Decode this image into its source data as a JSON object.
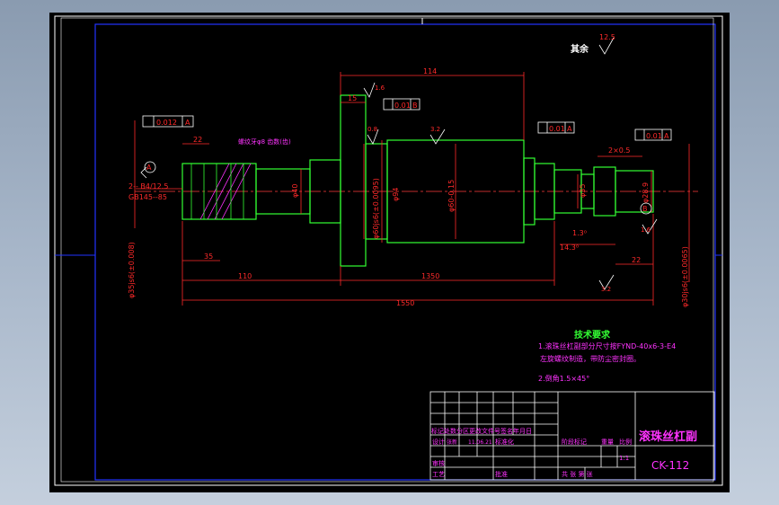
{
  "drawing": {
    "surface_note": "其余",
    "surface_roughness_general": "12.5",
    "dimensions": {
      "d114": "114",
      "d15": "15",
      "d22": "22",
      "d2x05": "2×0.5",
      "d35": "35",
      "d110": "110",
      "d1350": "1350",
      "d1550": "1550",
      "d22b": "22",
      "d143": "14.3⁰",
      "d13": "1.3⁰",
      "thread_spec": "2-- B4/12.5",
      "thread_std": "GB145--85"
    },
    "diameters": {
      "dia35": "φ35js6(±0.008)",
      "dia40": "φ40",
      "dia60js6": "φ60js6(±0.0095)",
      "dia94": "φ94",
      "dia60": "φ60-0.15",
      "dia35b": "φ35",
      "dia28": "φ28.9",
      "dia30": "φ30js6(±0.0065)"
    },
    "roughness": {
      "r16a": "1.6",
      "r08": "0.8",
      "r32": "3.2",
      "r16b": "1.6",
      "r32b": "3.2"
    },
    "tolerance_frames": {
      "runout_left": "0.012",
      "runout_left_ref": "A",
      "runout_top": "0.01",
      "runout_top_ref": "B",
      "runout_mid": "0.01",
      "runout_mid_ref": "A",
      "runout_right": "0.01",
      "runout_right_ref": "A"
    },
    "datum_left": "A",
    "datum_right": "B",
    "callout_text": "螺纹牙φ8\n齿数(齿)"
  },
  "requirements": {
    "heading": "技术要求",
    "line1": "1.滚珠丝杠副部分尺寸按FYND-40x6-3-E4",
    "line2": "左旋螺纹制造，带防尘密封圈。",
    "line3": "2.倒角1.5×45°"
  },
  "title_block": {
    "part_name": "滚珠丝杠副",
    "drawing_number": "CK-112",
    "row_change": "标记处数分区更改文件号签名年月日",
    "row_design": "设计",
    "designer_mark": "张新",
    "design_date": "11.06.21",
    "standardize": "标准化",
    "stage_label": "阶段标记",
    "weight_label": "重量",
    "scale_label": "比例",
    "scale_value": "1:1",
    "review_label": "审核",
    "process_label": "工艺",
    "approve_label": "批准",
    "sheet_info": "共 张  第 张"
  }
}
